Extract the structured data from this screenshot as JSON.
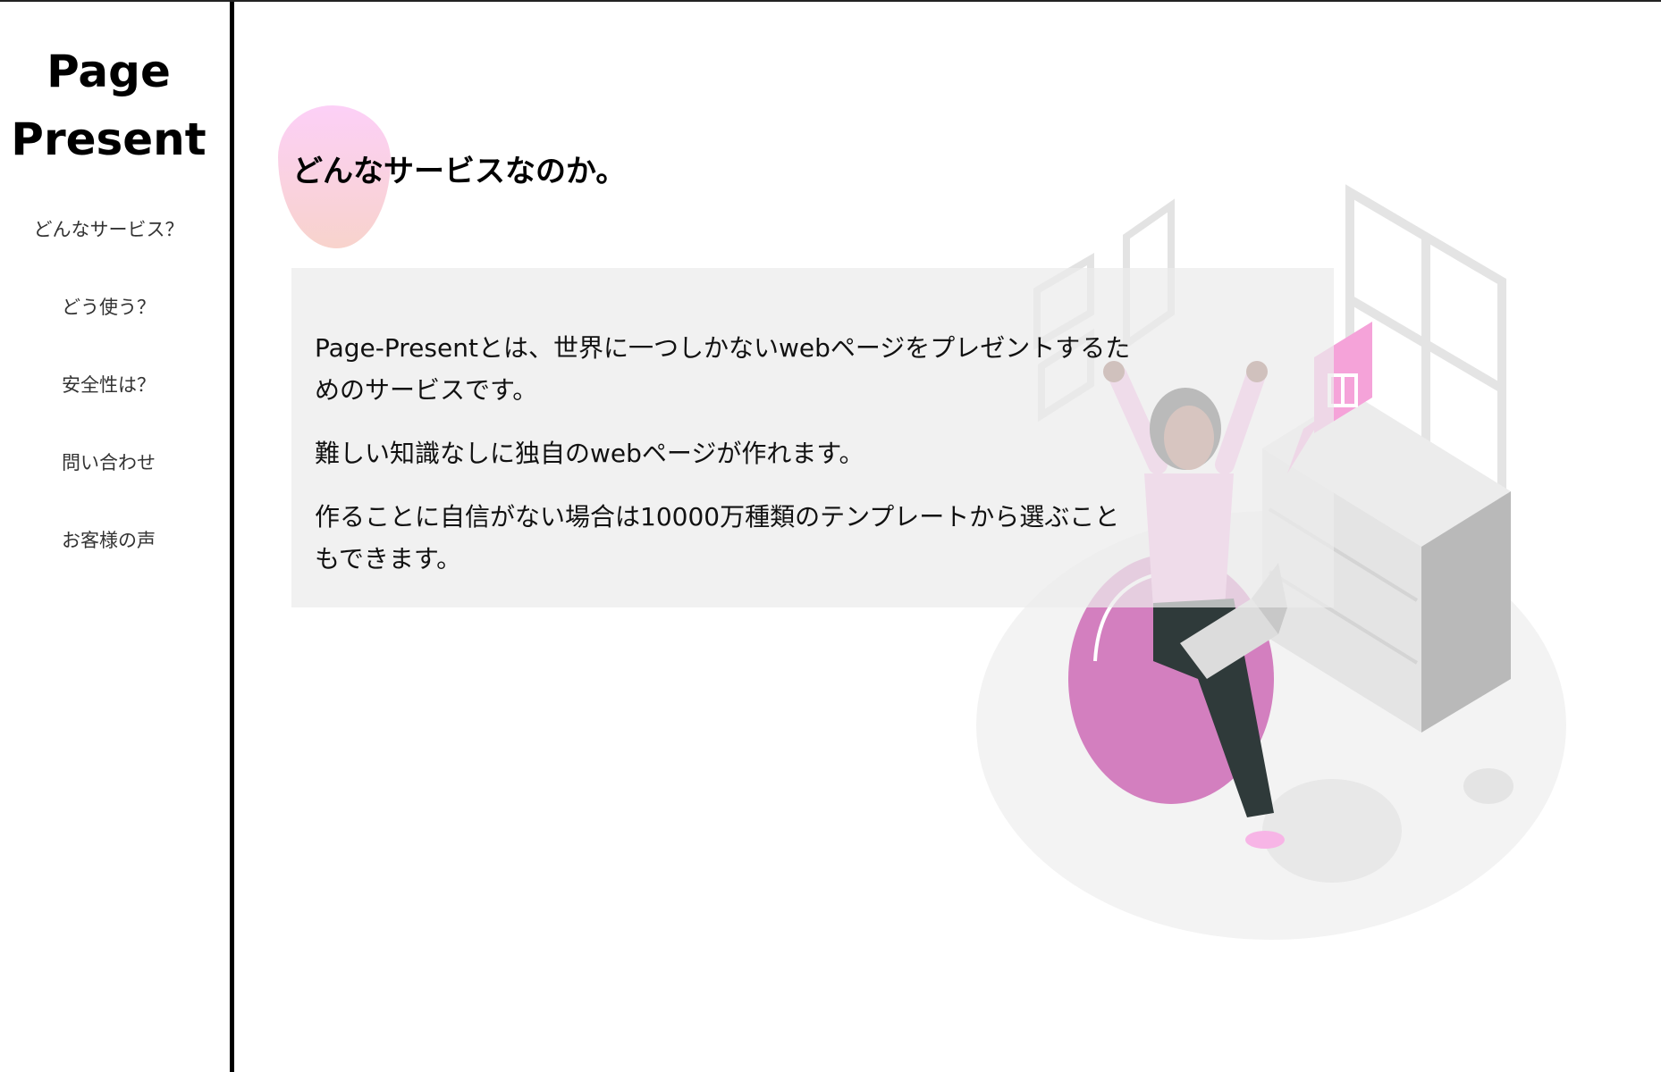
{
  "sidebar": {
    "logo_line1": "Page",
    "logo_line2": "Present",
    "nav": [
      {
        "label": "どんなサービス？"
      },
      {
        "label": "どう使う？"
      },
      {
        "label": "安全性は？"
      },
      {
        "label": "問い合わせ"
      },
      {
        "label": "お客様の声"
      }
    ]
  },
  "main": {
    "heading": "どんなサービスなのか。",
    "paragraphs": [
      "Page-Presentとは、世界に一つしかないwebページをプレゼントするためのサービスです。",
      "難しい知識なしに独自のwebページが作れます。",
      "作ることに自信がない場合は10000万種類のテンプレートから選ぶこともできます。"
    ]
  },
  "colors": {
    "accent_pink": "#f5a3d9",
    "blob_top": "#fcd0f7",
    "blob_bottom": "#f8d3cc",
    "panel_bg": "#ececec"
  }
}
